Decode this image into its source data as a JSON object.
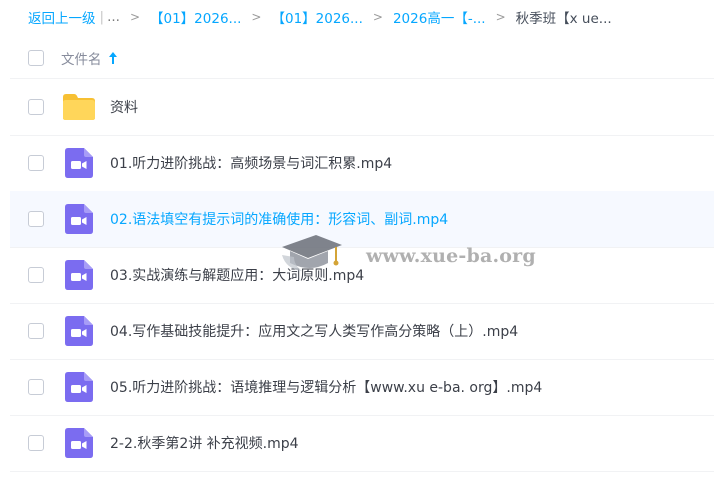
{
  "breadcrumb": {
    "back_label": "返回上一级",
    "separator": "|",
    "ellipsis": "...",
    "arrow": ">",
    "items": [
      {
        "label": "【01】2026..."
      },
      {
        "label": "【01】2026..."
      },
      {
        "label": "2026高一【-..."
      }
    ],
    "current": "秋季班【x ue..."
  },
  "table": {
    "column_title": "文件名",
    "sort_direction": "ascending",
    "rows": [
      {
        "type": "folder",
        "icon": "folder-icon",
        "name": "资料",
        "hover": false
      },
      {
        "type": "video",
        "icon": "video-file-icon",
        "name": "01.听力进阶挑战：高频场景与词汇积累.mp4",
        "hover": false
      },
      {
        "type": "video",
        "icon": "video-file-icon",
        "name": "02.语法填空有提示词的准确使用：形容词、副词.mp4",
        "hover": true
      },
      {
        "type": "video",
        "icon": "video-file-icon",
        "name": "03.实战演练与解题应用：大词原则.mp4",
        "hover": false
      },
      {
        "type": "video",
        "icon": "video-file-icon",
        "name": "04.写作基础技能提升：应用文之写人类写作高分策略（上）.mp4",
        "hover": false
      },
      {
        "type": "video",
        "icon": "video-file-icon",
        "name": "05.听力进阶挑战：语境推理与逻辑分析【www.xu e-ba. org】.mp4",
        "hover": false
      },
      {
        "type": "video",
        "icon": "video-file-icon",
        "name": "2-2.秋季第2讲 补充视频.mp4",
        "hover": false
      }
    ]
  },
  "watermark": {
    "text": "www.xue-ba.org",
    "icon": "graduation-cap-icon"
  },
  "colors": {
    "accent": "#06a7ff",
    "folder": "#ffd050",
    "video_icon": "#7b6cf0",
    "hover_row": "#f6f9ff"
  }
}
